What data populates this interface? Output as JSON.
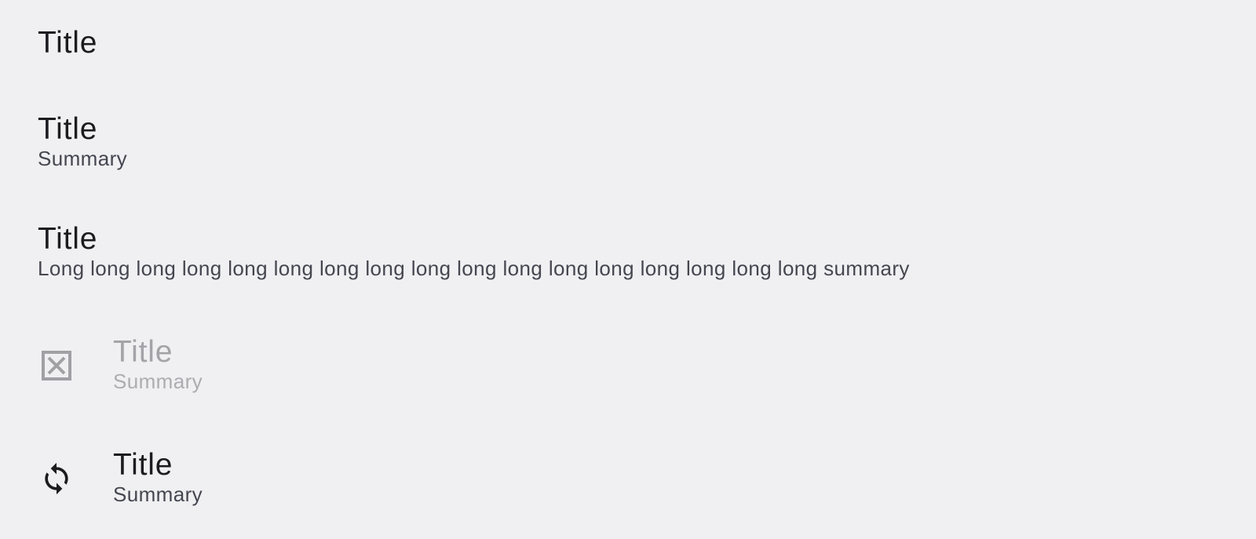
{
  "preferences": [
    {
      "title": "Title"
    },
    {
      "title": "Title",
      "summary": "Summary"
    },
    {
      "title": "Title",
      "summary": "Long long long long long long long long long long long long long long long long long summary"
    },
    {
      "title": "Title",
      "summary": "Summary",
      "icon": "disabled-box-x-icon",
      "enabled": false
    },
    {
      "title": "Title",
      "summary": "Summary",
      "icon": "sync-icon",
      "enabled": true
    }
  ],
  "colors": {
    "background": "#f0f0f3",
    "title": "#1c1b1f",
    "summary": "#45464f",
    "disabled_title": "#a3a3a8",
    "disabled_summary": "#acacb1",
    "disabled_icon": "#a0a0a5",
    "icon": "#1c1b1f"
  }
}
